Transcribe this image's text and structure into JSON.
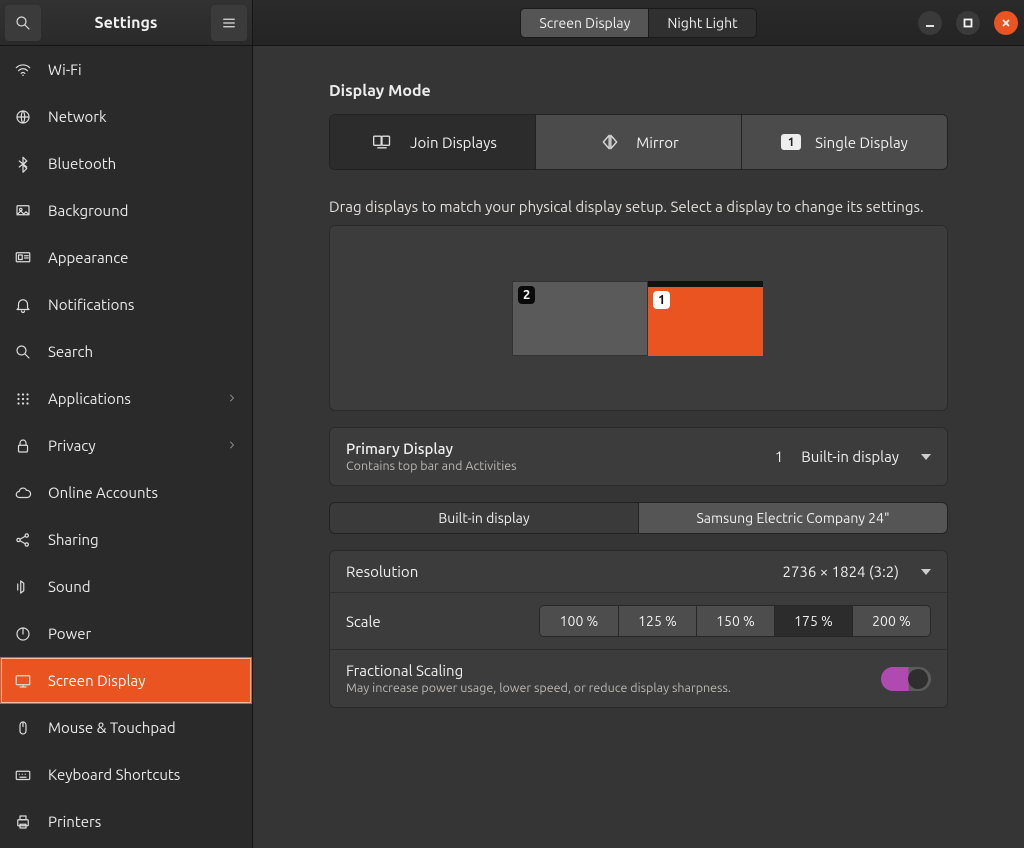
{
  "titlebar": {
    "app_title": "Settings",
    "tabs": [
      "Screen Display",
      "Night Light"
    ],
    "active_tab": 0
  },
  "sidebar": {
    "items": [
      {
        "icon": "wifi",
        "label": "Wi-Fi"
      },
      {
        "icon": "globe",
        "label": "Network"
      },
      {
        "icon": "bluetooth",
        "label": "Bluetooth"
      },
      {
        "icon": "background",
        "label": "Background"
      },
      {
        "icon": "appearance",
        "label": "Appearance"
      },
      {
        "icon": "bell",
        "label": "Notifications"
      },
      {
        "icon": "search",
        "label": "Search"
      },
      {
        "icon": "apps",
        "label": "Applications",
        "chevron": true
      },
      {
        "icon": "lock",
        "label": "Privacy",
        "chevron": true
      },
      {
        "icon": "cloud",
        "label": "Online Accounts"
      },
      {
        "icon": "share",
        "label": "Sharing"
      },
      {
        "icon": "sound",
        "label": "Sound"
      },
      {
        "icon": "power",
        "label": "Power"
      },
      {
        "icon": "display",
        "label": "Screen Display",
        "active": true
      },
      {
        "icon": "mouse",
        "label": "Mouse & Touchpad"
      },
      {
        "icon": "keyboard",
        "label": "Keyboard Shortcuts"
      },
      {
        "icon": "printer",
        "label": "Printers"
      }
    ]
  },
  "main": {
    "display_mode_title": "Display Mode",
    "modes": [
      {
        "id": "join",
        "label": "Join Displays",
        "active": true
      },
      {
        "id": "mirror",
        "label": "Mirror"
      },
      {
        "id": "single",
        "label": "Single Display"
      }
    ],
    "hint": "Drag displays to match your physical display setup. Select a display to change its settings.",
    "arrangement": {
      "displays": [
        {
          "num": "2",
          "primary": false
        },
        {
          "num": "1",
          "primary": true
        }
      ]
    },
    "primary": {
      "title": "Primary Display",
      "subtitle": "Contains top bar and Activities",
      "value_num": "1",
      "value_name": "Built-in display"
    },
    "display_tabs": {
      "items": [
        "Built-in display",
        "Samsung Electric Company 24\""
      ],
      "active": 0
    },
    "resolution": {
      "label": "Resolution",
      "value": "2736 × 1824 (3:2)"
    },
    "scale": {
      "label": "Scale",
      "options": [
        "100 %",
        "125 %",
        "150 %",
        "175 %",
        "200 %"
      ],
      "active": 3
    },
    "fractional": {
      "label": "Fractional Scaling",
      "subtitle": "May increase power usage, lower speed, or reduce display sharpness.",
      "on": true
    }
  }
}
